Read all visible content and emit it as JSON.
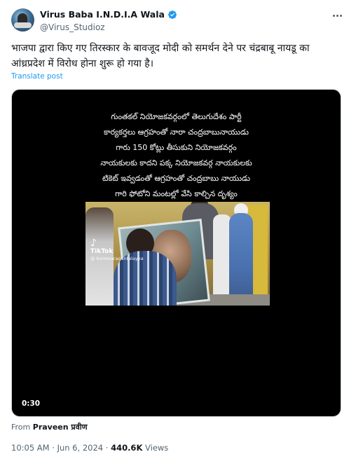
{
  "author": {
    "display_name": "Virus Baba I.N.D.I.A Wala",
    "handle": "@Virus_Studioz",
    "verified_color": "#1d9bf0"
  },
  "tweet": {
    "text": "भाजपा द्वारा किए गए तिरस्कार के बावजूद मोदी को समर्थन देने पर चंद्रबाबू नायडू का आंध्रप्रदेश में विरोध होना शुरू हो गया है।",
    "translate_label": "Translate post"
  },
  "video": {
    "overlay_lines": [
      "గుంతకల్ నియోజకవర్గంలో తెలుగుదేశం పార్టీ",
      "కార్యకర్తలు ఆగ్రహంతో నారా చంద్రబాబునాయుడు",
      "గారు 150 కోట్లు తీసుకుని నియోజకవర్గం",
      "నాయకులకు కాదని పక్క నియోజకవర్గ నాయకులకు",
      "టికెట్ ఇవ్వడంతో ఆగ్రహంతో చంద్రబాబు నాయుడు",
      "గారి ఫోటోని మంటల్లో వేసి కాల్చిన దృశ్యం"
    ],
    "tiktok_label": "TikTok",
    "tiktok_user": "@ kommaragantalayya",
    "duration": "0:30"
  },
  "source": {
    "prefix": "From",
    "name": "Praveen प्रवीण"
  },
  "meta": {
    "time": "10:05 AM",
    "separator": "·",
    "date": "Jun 6, 2024",
    "views_count": "440.6K",
    "views_label": "Views"
  },
  "icons": {
    "verified": "verified-badge-icon",
    "more": "more-options-icon"
  }
}
